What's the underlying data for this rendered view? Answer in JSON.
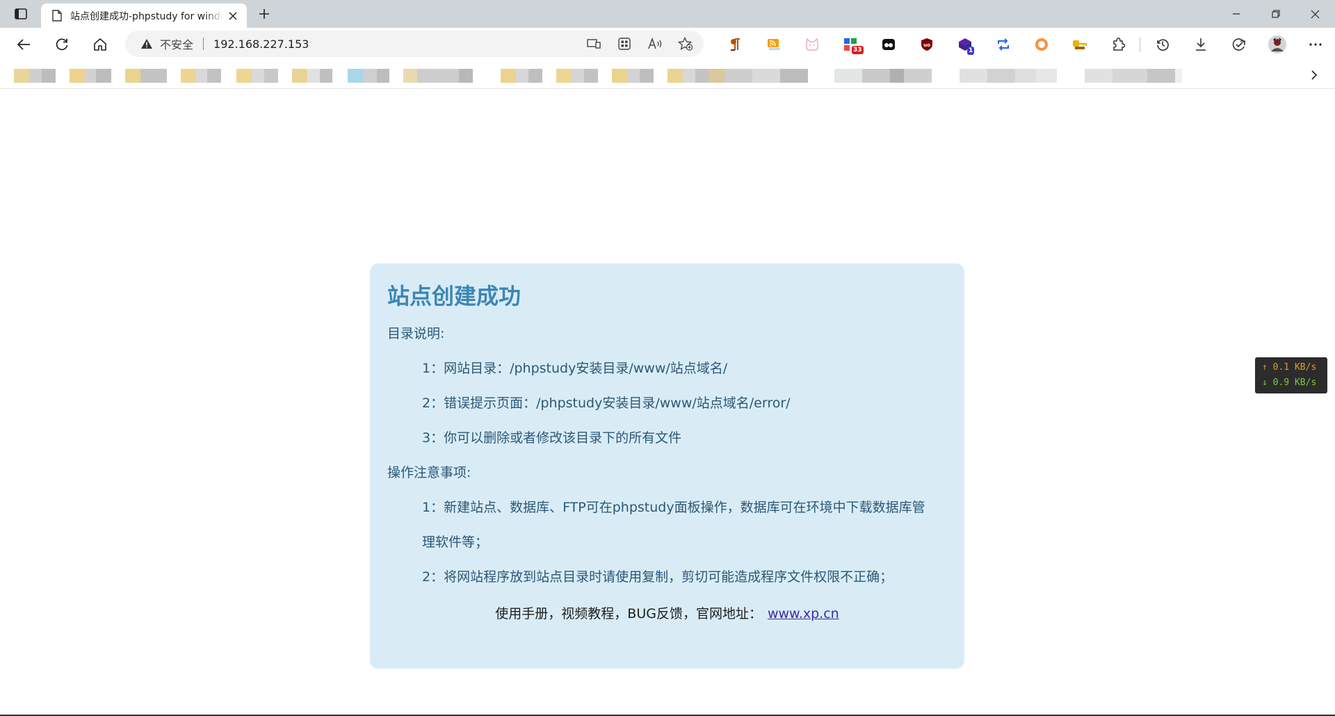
{
  "browser": {
    "tab": {
      "title": "站点创建成功-phpstudy for windows"
    },
    "address_bar": {
      "security_label": "不安全",
      "url": "192.168.227.153"
    },
    "extensions": [
      {
        "name": "pilcrow-extension-icon",
        "badge": ""
      },
      {
        "name": "rss-extension-icon",
        "badge": ""
      },
      {
        "name": "cat-extension-icon",
        "badge": ""
      },
      {
        "name": "todo-extension-icon",
        "badge": "33"
      },
      {
        "name": "glasses-extension-icon",
        "badge": ""
      },
      {
        "name": "ublock-extension-icon",
        "badge": ""
      },
      {
        "name": "cube-extension-icon",
        "badge": "1"
      },
      {
        "name": "sync-extension-icon",
        "badge": ""
      },
      {
        "name": "ring-extension-icon",
        "badge": ""
      },
      {
        "name": "key-extension-icon",
        "badge": ""
      }
    ],
    "colors": {
      "tabstrip": "#cfd4d8",
      "card_background": "#d9ecf6",
      "heading": "#3c86b4",
      "body_text": "#2c5777",
      "link": "#3a2aa5"
    }
  },
  "page": {
    "heading": "站点创建成功",
    "directory_section": {
      "title": "目录说明:",
      "items": [
        "1：网站目录：/phpstudy安装目录/www/站点域名/",
        "2：错误提示页面：/phpstudy安装目录/www/站点域名/error/",
        "3：你可以删除或者修改该目录下的所有文件"
      ]
    },
    "notes_section": {
      "title": "操作注意事项:",
      "items": [
        "1：新建站点、数据库、FTP可在phpstudy面板操作，数据库可在环境中下载数据库管",
        "理软件等；",
        "2：将网站程序放到站点目录时请使用复制，剪切可能造成程序文件权限不正确；"
      ]
    },
    "footer": {
      "text": "使用手册，视频教程，BUG反馈，官网地址：",
      "link_text": "www.xp.cn"
    }
  },
  "net_speed": {
    "up": "↑ 0.1 KB/s",
    "down": "↓ 0.9 KB/s"
  }
}
